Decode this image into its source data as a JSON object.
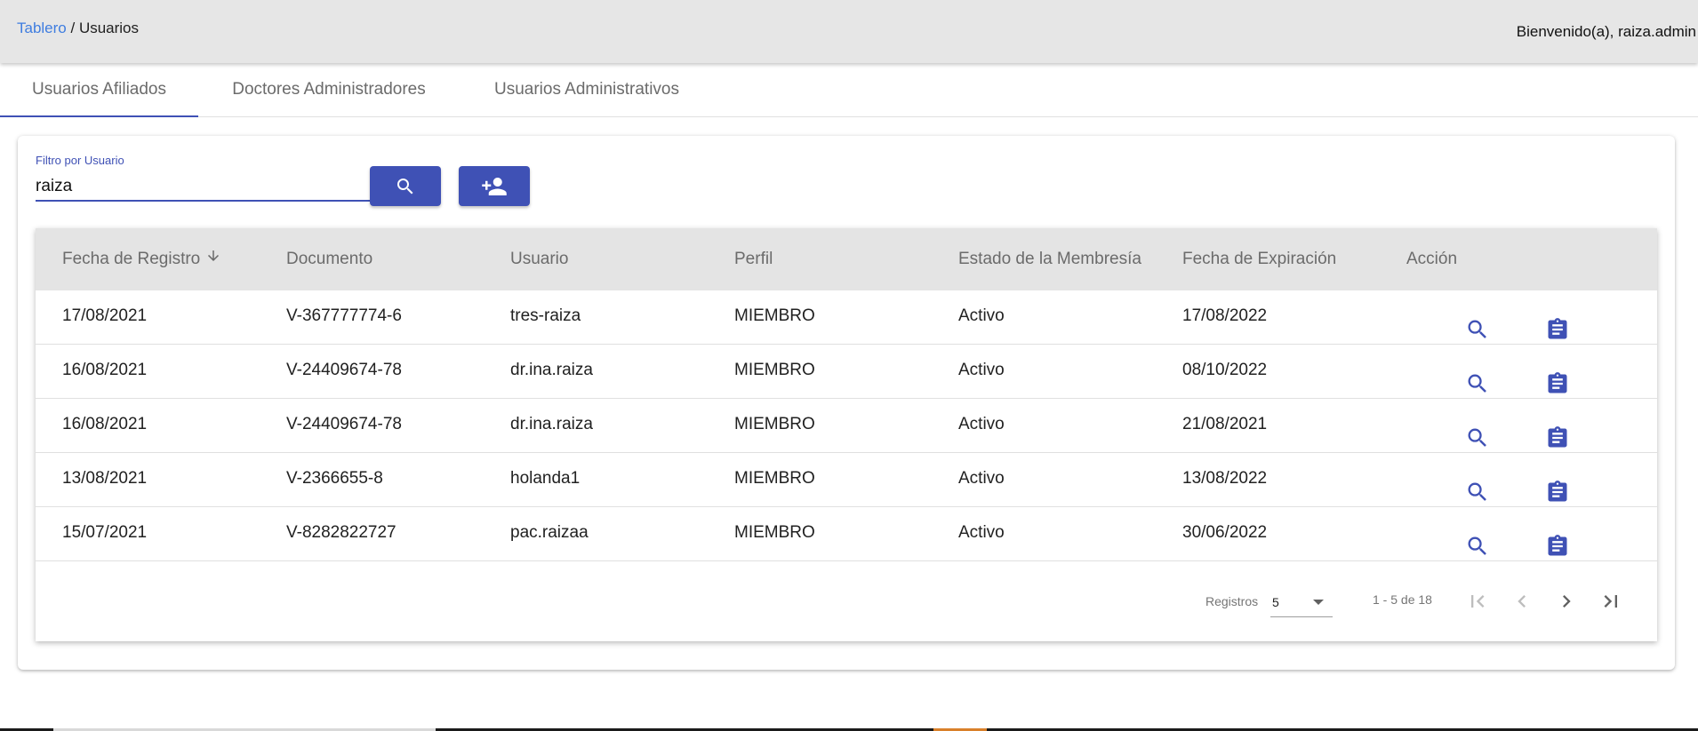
{
  "breadcrumb": {
    "link": "Tablero",
    "separator": " / ",
    "current": "Usuarios"
  },
  "welcome": "Bienvenido(a), raiza.admin",
  "tabs": [
    {
      "label": "Usuarios Afiliados",
      "active": true
    },
    {
      "label": "Doctores Administradores",
      "active": false
    },
    {
      "label": "Usuarios Administrativos",
      "active": false
    }
  ],
  "filter": {
    "label": "Filtro por Usuario",
    "value": "raiza"
  },
  "buttons": {
    "search_icon": "search-icon",
    "add_icon": "person-add-icon"
  },
  "table": {
    "headers": [
      "Fecha de Registro",
      "Documento",
      "Usuario",
      "Perfil",
      "Estado de la Membresía",
      "Fecha de Expiración",
      "Acción"
    ],
    "sort": {
      "column": "Fecha de Registro",
      "direction": "desc"
    },
    "rows": [
      [
        "17/08/2021",
        "V-367777774-6",
        "tres-raiza",
        "MIEMBRO",
        "Activo",
        "17/08/2022"
      ],
      [
        "16/08/2021",
        "V-24409674-78",
        "dr.ina.raiza",
        "MIEMBRO",
        "Activo",
        "08/10/2022"
      ],
      [
        "16/08/2021",
        "V-24409674-78",
        "dr.ina.raiza",
        "MIEMBRO",
        "Activo",
        "21/08/2021"
      ],
      [
        "13/08/2021",
        "V-2366655-8",
        "holanda1",
        "MIEMBRO",
        "Activo",
        "13/08/2022"
      ],
      [
        "15/07/2021",
        "V-8282822727",
        "pac.raizaa",
        "MIEMBRO",
        "Activo",
        "30/06/2022"
      ]
    ],
    "action_icons": [
      "search-icon",
      "clipboard-icon"
    ]
  },
  "paginator": {
    "label": "Registros",
    "page_size": "5",
    "range": "1 - 5 de 18"
  },
  "colors": {
    "primary": "#3f51b5",
    "link": "#3f7de0",
    "header_bg": "#e4e4e4",
    "topbar_bg": "#e6e6e6"
  }
}
